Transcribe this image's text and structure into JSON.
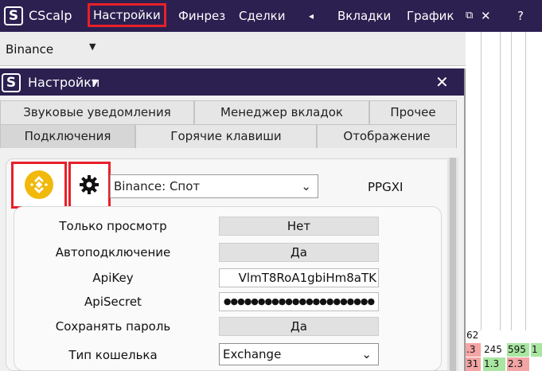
{
  "topbar": {
    "app_name": "CScalp",
    "menu": {
      "settings": "Настройки",
      "finrez": "Финрез",
      "deals": "Сделки",
      "tabs": "Вкладки",
      "chart": "График"
    },
    "back_glyph": "◂",
    "window_glyph": "⧉",
    "close_glyph": "✕",
    "help": "?"
  },
  "exchange_bar": {
    "exchange": "Binance",
    "dropdown_glyph": "▼"
  },
  "orderbook": {
    "cells": [
      "62",
      ".3",
      "245",
      "595",
      "1",
      "31",
      "1.3",
      "2.3"
    ]
  },
  "dialog": {
    "title": "Настройки",
    "title_arrow": "▾",
    "close": "✕",
    "tabs_row1": [
      "Звуковые уведомления",
      "Менеджер вкладок",
      "Прочее"
    ],
    "tabs_row2": [
      "Подключения",
      "Горячие клавиши",
      "Отображение"
    ],
    "active_tab": "Подключения",
    "connection": {
      "exchange_select": "Binance: Спот",
      "select_arrow": "⌄",
      "account": "PPGXI",
      "icons": {
        "exchange": "binance-logo-icon",
        "settings": "gear-icon"
      },
      "accent": "#f0b90b"
    },
    "fields": {
      "view_only": {
        "label": "Только просмотр",
        "value": "Нет"
      },
      "auto_connect": {
        "label": "Автоподключение",
        "value": "Да"
      },
      "api_key": {
        "label": "ApiKey",
        "value": "VlmT8RoA1gbiHm8aTK"
      },
      "api_secret": {
        "label": "ApiSecret",
        "value": "●●●●●●●●●●●●●●●●●●●●●●"
      },
      "save_password": {
        "label": "Сохранять пароль",
        "value": "Да"
      },
      "wallet_type": {
        "label": "Тип кошелька",
        "value": "Exchange"
      }
    }
  },
  "colors": {
    "titlebar": "#2b2050",
    "highlight": "#e8202a",
    "sell": "#f3a4a4",
    "buy": "#a9e6a2"
  }
}
